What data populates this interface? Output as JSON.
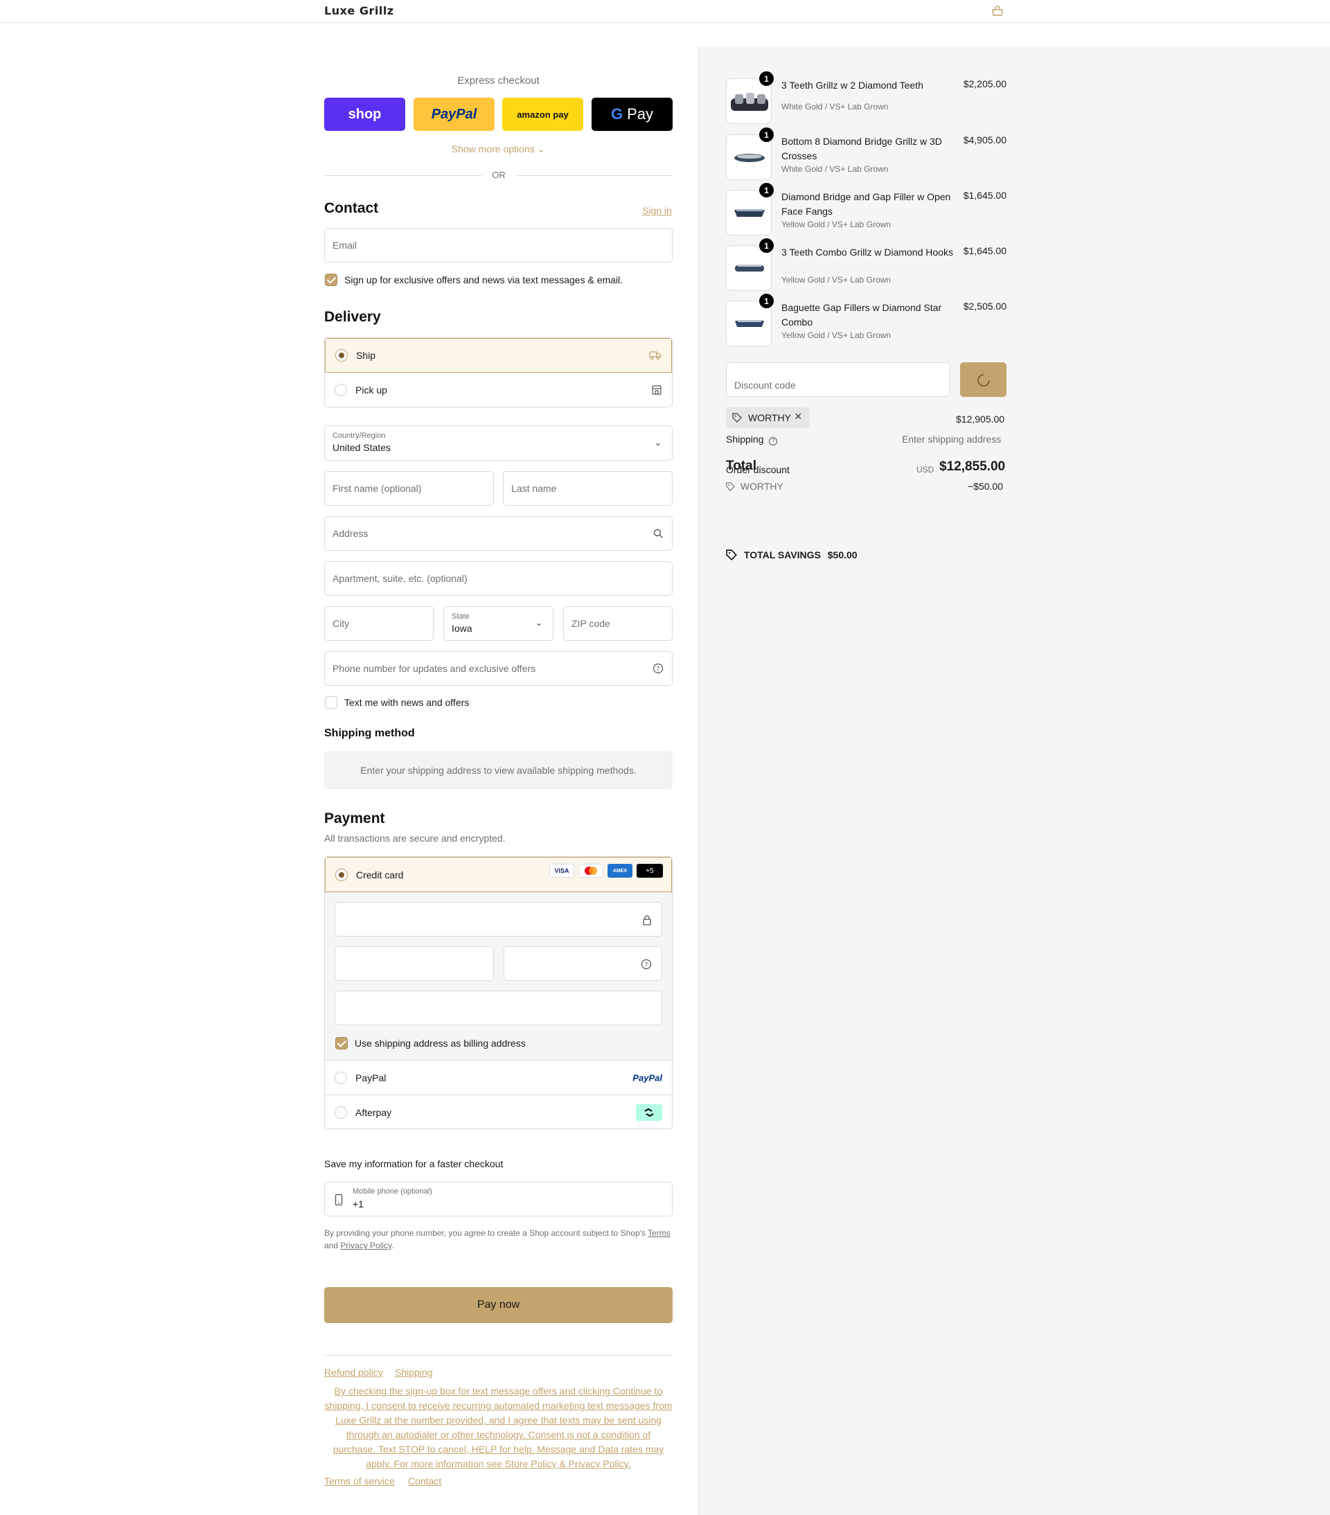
{
  "header": {
    "brand": "Luxe Grillz",
    "cart_icon": "bag-icon"
  },
  "express": {
    "title": "Express checkout",
    "buttons": {
      "shop": "shop",
      "paypal": "PayPal",
      "amazon": "amazon pay",
      "gpay": "Pay"
    },
    "show_more": "Show more options",
    "or": "OR"
  },
  "contact": {
    "title": "Contact",
    "sign_in": "Sign in",
    "email_placeholder": "Email",
    "newsletter_label": "Sign up for exclusive offers and news via text messages & email.",
    "newsletter_checked": true
  },
  "delivery": {
    "title": "Delivery",
    "options": [
      {
        "label": "Ship",
        "selected": true,
        "icon": "truck-icon"
      },
      {
        "label": "Pick up",
        "selected": false,
        "icon": "store-icon"
      }
    ],
    "country_label": "Country/Region",
    "country_value": "United States",
    "first_name": "First name (optional)",
    "last_name": "Last name",
    "address": "Address",
    "apartment": "Apartment, suite, etc. (optional)",
    "city": "City",
    "state_label": "State",
    "state_value": "Iowa",
    "zip": "ZIP code",
    "phone": "Phone number for updates and exclusive offers",
    "text_me": "Text me with news and offers",
    "text_me_checked": false
  },
  "shipping_method": {
    "title": "Shipping method",
    "message": "Enter your shipping address to view available shipping methods."
  },
  "payment": {
    "title": "Payment",
    "subtitle": "All transactions are secure and encrypted.",
    "credit_card": "Credit card",
    "card_brands": [
      "VISA",
      "MC",
      "AMEX",
      "+5"
    ],
    "billing_label": "Use shipping address as billing address",
    "billing_checked": true,
    "paypal": "PayPal",
    "paypal_logo": "PayPal",
    "afterpay": "Afterpay"
  },
  "save_info": {
    "title": "Save my information for a faster checkout",
    "mobile_label": "Mobile phone (optional)",
    "mobile_value": "+1",
    "note_prefix": "By providing your phone number, you agree to create a Shop account subject to Shop's",
    "terms": "Terms",
    "and": "and",
    "privacy": "Privacy Policy",
    "period": "."
  },
  "pay_now": "Pay now",
  "footer": {
    "refund": "Refund policy",
    "shipping": "Shipping",
    "consent": "By checking the sign-up box for text message offers and clicking Continue to shipping, I consent to receive recurring automated marketing text messages from Luxe Grillz at the number provided, and I agree that texts may be sent using through an autodialer or other technology. Consent is not a condition of purchase. Text STOP to cancel, HELP for help. Message and Data rates may apply. For more information see Store Policy & Privacy Policy.",
    "terms_of_service": "Terms of service",
    "contact": "Contact"
  },
  "summary": {
    "items": [
      {
        "qty": "1",
        "name": "3 Teeth Grillz w 2 Diamond Teeth",
        "variant": "White Gold / VS+ Lab Grown",
        "price": "$2,205.00"
      },
      {
        "qty": "1",
        "name": "Bottom 8 Diamond Bridge Grillz w 3D Crosses",
        "variant": "White Gold / VS+ Lab Grown",
        "price": "$4,905.00"
      },
      {
        "qty": "1",
        "name": "Diamond Bridge and Gap Filler w Open Face Fangs",
        "variant": "Yellow Gold / VS+ Lab Grown",
        "price": "$1,645.00"
      },
      {
        "qty": "1",
        "name": "3 Teeth Combo Grillz w Diamond Hooks",
        "variant": "Yellow Gold / VS+ Lab Grown",
        "price": "$1,645.00"
      },
      {
        "qty": "1",
        "name": "Baguette Gap Fillers w Diamond Star Combo",
        "variant": "Yellow Gold / VS+ Lab Grown",
        "price": "$2,505.00"
      }
    ],
    "discount_placeholder": "Discount code",
    "applied_code": "WORTHY",
    "subtotal_value": "$12,905.00",
    "shipping_label": "Shipping",
    "shipping_value": "Enter shipping address",
    "total_label": "Total",
    "order_discount_label": "Order discount",
    "currency": "USD",
    "total_value": "$12,855.00",
    "discount_code": "WORTHY",
    "discount_value": "−$50.00",
    "savings_label": "TOTAL SAVINGS",
    "savings_value": "$50.00"
  }
}
